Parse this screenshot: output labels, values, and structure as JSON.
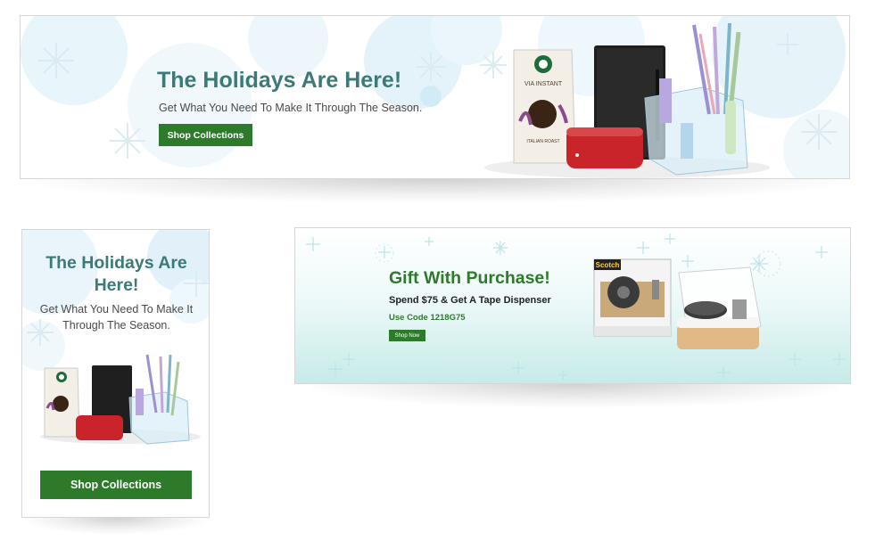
{
  "colors": {
    "brand_green": "#2d7a2a",
    "title_teal": "#3b7b77",
    "snow": "#e6f4fa"
  },
  "banner_wide": {
    "title": "The Holidays Are Here!",
    "subtitle": "Get What You Need To Make It Through The Season.",
    "button_label": "Shop Collections"
  },
  "banner_vertical": {
    "title_line1": "The Holidays Are",
    "title_line2": "Here!",
    "subtitle_line1": "Get What You Need To Make It",
    "subtitle_line2": "Through The Season.",
    "button_label": "Shop Collections"
  },
  "banner_gift": {
    "title": "Gift With Purchase!",
    "subtitle": "Spend $75 & Get A Tape Dispenser",
    "code_text": "Use Code 1218G75",
    "button_label": "Shop Now"
  },
  "product_labels": {
    "coffee_line1": "VIA INSTANT",
    "coffee_line2": "ITALIAN ROAST",
    "tape_brand": "Scotch"
  },
  "icons": [
    "snowflake-icon",
    "coffee-pouch-icon",
    "notebook-icon",
    "battery-pack-icon",
    "desk-organizer-icon",
    "tape-dispenser-icon"
  ]
}
